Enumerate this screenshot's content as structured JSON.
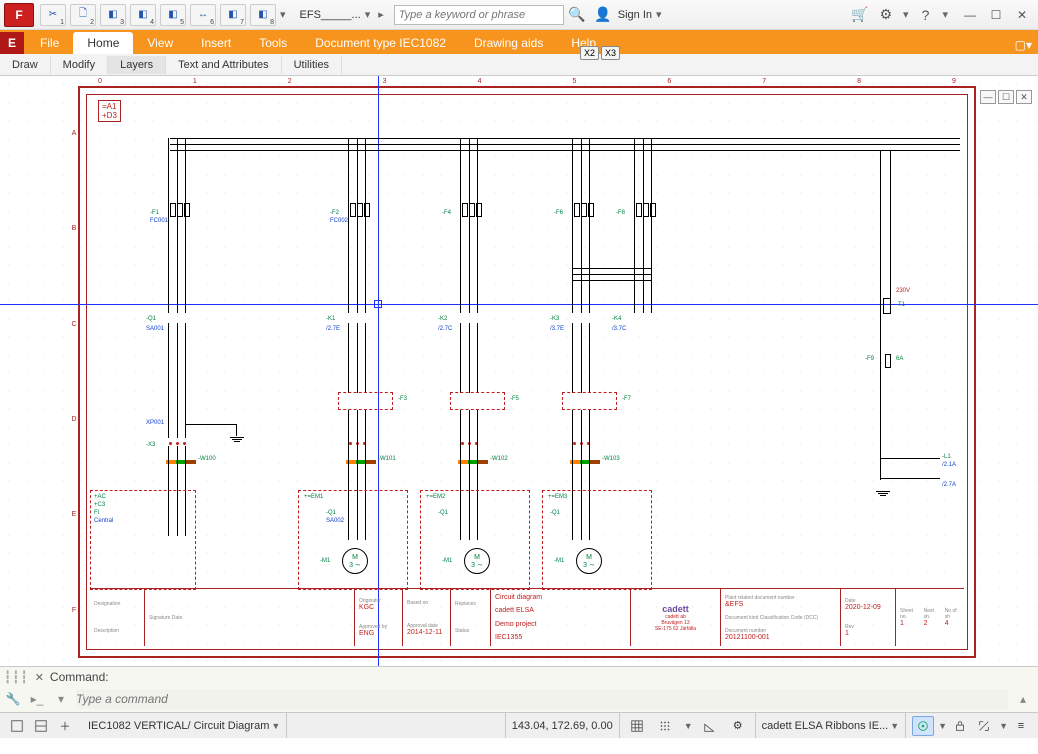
{
  "titlebar": {
    "app_letter": "F",
    "qat_numbers": [
      "1",
      "2",
      "3",
      "4",
      "5",
      "6",
      "7",
      "8"
    ],
    "filename": "EFS_____...",
    "search_placeholder": "Type a keyword or phrase",
    "signin": "Sign In"
  },
  "ribbon": {
    "e_tab": "E",
    "tabs": [
      "File",
      "Home",
      "View",
      "Insert",
      "Tools",
      "Document type IEC1082",
      "Drawing aids",
      "Help"
    ],
    "active": "Home",
    "hints": [
      "X2",
      "X3"
    ]
  },
  "subtabs": {
    "items": [
      "Draw",
      "Modify",
      "Layers",
      "Text and Attributes",
      "Utilities"
    ],
    "active": "Layers"
  },
  "drawing": {
    "ruler_top": [
      "0",
      "1",
      "2",
      "3",
      "4",
      "5",
      "6",
      "7",
      "8",
      "9"
    ],
    "ruler_left": [
      "A",
      "B",
      "C",
      "D",
      "E",
      "F"
    ],
    "ref_a1": "=A1",
    "ref_d3": "+D3",
    "components": {
      "f1": "-F1",
      "f2": "-F2",
      "f4": "-F4",
      "f5": "-F6",
      "f6": "-F8",
      "q1": "-Q1",
      "k1": "-K1",
      "k2": "-K2",
      "k3": "-K3",
      "k4": "-K4",
      "t1": "-T1",
      "f3": "-F3",
      "f5b": "-F5",
      "f7": "-F7",
      "f9": "-F9",
      "x3": "-X3",
      "w100": "-W100",
      "w101": "-W101",
      "w102": "-W102",
      "w103": "-W103",
      "q1b": "-Q1",
      "m1": "-M1",
      "ac": "+AC",
      "c3": "+C3",
      "fi": "Fl",
      "central": "Central",
      "pe": "XP001",
      "sa": "SA001",
      "sa2": "SA002",
      "fc": "FC001",
      "fc2": "FC002",
      "l1": "-L1",
      "amp1": "6A",
      "volt1": "230V",
      "link1": "/2.1A",
      "link2": "/2.7A",
      "mref": "M\n3 ∼"
    },
    "titleblock": {
      "originator_h": "Originator",
      "originator_v": "KGC",
      "basedon_h": "Based on",
      "approved_h": "Approved by",
      "approved_v": "ENG",
      "appdate_h": "Approval date",
      "appdate_v": "2014-12-11",
      "replaces_h": "Replaces",
      "status_h": "Status",
      "desc1": "Circuit diagram",
      "desc2": "cadett ELSA",
      "desc3": "Demo project",
      "desc4": "IEC1355",
      "logo_name": "cadett",
      "logo_sub": "cadett ab",
      "addr1": "Bruvägen 13",
      "addr2": "SE-175 62 Järfälla",
      "plant_h": "Plant related document number",
      "plant_v": "&EFS",
      "dcc_h": "Document kind Classification Code (DCC)",
      "date_h": "Date",
      "date_v": "2020-12-09",
      "docnum_h": "Document number",
      "docnum_v": "20121100-001",
      "rev_h": "Rev",
      "rev_v": "1",
      "sheet_h": "Sheet no.",
      "sheet_v": "1",
      "next_h": "Next sh.",
      "next_v": "2",
      "total_h": "No of sh",
      "total_v": "4",
      "designation_h": "Designation",
      "description_h": "Description",
      "sigdate_h": "Signature Date"
    }
  },
  "command": {
    "label": "Command:",
    "placeholder": "Type a command"
  },
  "status": {
    "layout": "IEC1082 VERTICAL/ Circuit Diagram",
    "coords": "143.04, 172.69, 0.00",
    "workspace": "cadett ELSA Ribbons IE..."
  }
}
